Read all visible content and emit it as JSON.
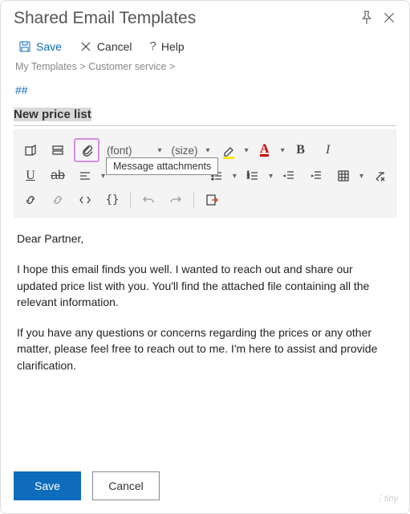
{
  "window": {
    "title": "Shared Email Templates"
  },
  "actions": {
    "save": "Save",
    "cancel": "Cancel",
    "help": "Help"
  },
  "breadcrumbs": {
    "root": "My Templates",
    "folder": "Customer service",
    "sep": ">"
  },
  "shortcut_prefix": "##",
  "subject": "New price list",
  "toolbar": {
    "font_label": "(font)",
    "size_label": "(size)",
    "tooltip_attachment": "Message attachments"
  },
  "body": {
    "greeting": "Dear Partner,",
    "p1": "I hope this email finds you well. I wanted to reach out and share our updated price list with you. You'll find the attached file containing all the relevant information.",
    "p2": "If you have any questions or concerns regarding the prices or any other matter, please feel free to reach out to me. I'm here to assist and provide clarification."
  },
  "footer": {
    "save": "Save",
    "cancel": "Cancel"
  },
  "branding": "tiny"
}
